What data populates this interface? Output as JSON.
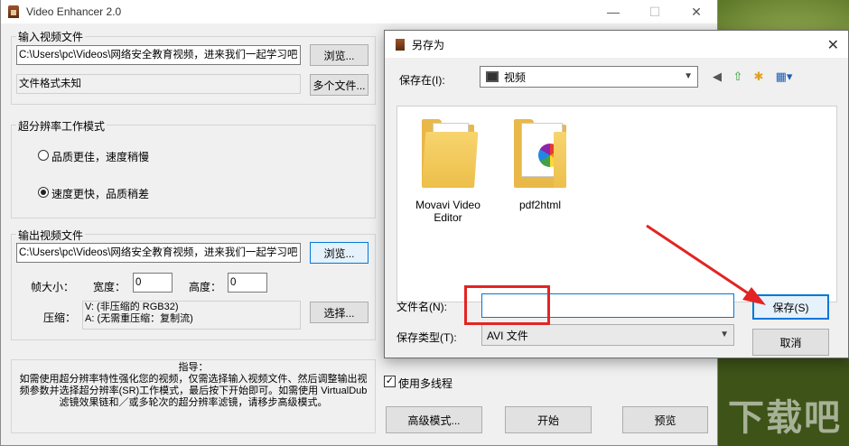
{
  "main_window": {
    "title": "Video Enhancer 2.0",
    "input_group": {
      "label": "输入视频文件",
      "path_value": "C:\\Users\\pc\\Videos\\网络安全教育视频，进来我们一起学习吧",
      "browse_label": "浏览...",
      "format_text": "文件格式未知",
      "multi_file_label": "多个文件..."
    },
    "mode_group": {
      "label": "超分辨率工作模式",
      "options": [
        "品质更佳，速度稍慢",
        "速度更快，品质稍差"
      ],
      "selected_index": 1
    },
    "output_group": {
      "label": "输出视频文件",
      "path_value": "C:\\Users\\pc\\Videos\\网络安全教育视频，进来我们一起学习吧",
      "browse_label": "浏览...",
      "frame_size_label": "帧大小：",
      "width_label": "宽度：",
      "width_value": "0",
      "height_label": "高度：",
      "height_value": "0",
      "compression_label": "压缩：",
      "compression_v": "V: (非压缩的 RGB32)",
      "compression_a": "A: (无需重压缩：复制流)",
      "select_label": "选择..."
    },
    "guide": {
      "title": "指导：",
      "text": "如需使用超分辨率特性强化您的视频，仅需选择输入视频文件、然后调整输出视频参数并选择超分辨率(SR)工作模式，最后按下开始即可。如需使用 VirtualDub 滤镜效果链和／或多轮次的超分辨率滤镜，请移步高级模式。"
    },
    "multithread_label": "使用多线程",
    "multithread_checked": true,
    "buttons": {
      "advanced": "高级模式...",
      "start": "开始",
      "preview": "预览"
    }
  },
  "save_dialog": {
    "title": "另存为",
    "save_in_label": "保存在(I):",
    "save_in_value": "视频",
    "files": [
      {
        "name_line1": "Movavi Video",
        "name_line2": "Editor",
        "icon": "folder-icon"
      },
      {
        "name_line1": "pdf2html",
        "name_line2": "",
        "icon": "folder-with-pinwheel-icon"
      }
    ],
    "filename_label": "文件名(N):",
    "filename_value": "",
    "filetype_label": "保存类型(T):",
    "filetype_value": "AVI 文件",
    "save_button": "保存(S)",
    "cancel_button": "取消"
  },
  "annotation_color": "#e32424",
  "watermark_text": "下载吧"
}
